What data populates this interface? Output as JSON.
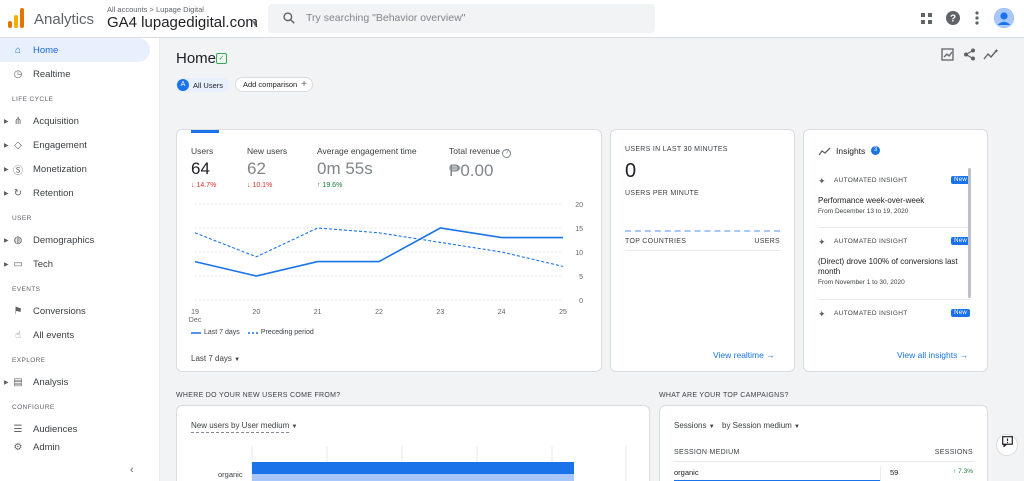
{
  "header": {
    "app_name": "Analytics",
    "account_crumb": "All accounts > Lupage Digital",
    "property": "GA4 lupagedigital.com",
    "search_placeholder": "Try searching \"Behavior overview\""
  },
  "sidebar": {
    "items": [
      {
        "label": "Home",
        "icon": "home-icon",
        "active": true
      },
      {
        "label": "Realtime",
        "icon": "clock-icon"
      }
    ],
    "sections": [
      {
        "title": "LIFE CYCLE",
        "items": [
          {
            "label": "Acquisition",
            "icon": "acquisition-icon"
          },
          {
            "label": "Engagement",
            "icon": "tag-icon"
          },
          {
            "label": "Monetization",
            "icon": "dollar-icon"
          },
          {
            "label": "Retention",
            "icon": "retention-icon"
          }
        ]
      },
      {
        "title": "USER",
        "items": [
          {
            "label": "Demographics",
            "icon": "globe-icon"
          },
          {
            "label": "Tech",
            "icon": "device-icon"
          }
        ]
      },
      {
        "title": "EVENTS",
        "items": [
          {
            "label": "Conversions",
            "icon": "flag-icon"
          },
          {
            "label": "All events",
            "icon": "touch-icon"
          }
        ]
      },
      {
        "title": "EXPLORE",
        "items": [
          {
            "label": "Analysis",
            "icon": "analysis-icon"
          }
        ]
      },
      {
        "title": "CONFIGURE",
        "items": [
          {
            "label": "Audiences",
            "icon": "audiences-icon"
          },
          {
            "label": "Admin",
            "icon": "gear-icon"
          }
        ]
      }
    ]
  },
  "main": {
    "title": "Home",
    "comparison_chip": "All Users",
    "comparison_chip_letter": "A",
    "add_comparison": "Add comparison"
  },
  "overview": {
    "metrics": [
      {
        "label": "Users",
        "value": "64",
        "change": "14.7%",
        "direction": "down"
      },
      {
        "label": "New users",
        "value": "62",
        "change": "10.1%",
        "direction": "down"
      },
      {
        "label": "Average engagement time",
        "value": "0m 55s",
        "change": "19.6%",
        "direction": "up"
      },
      {
        "label": "Total revenue",
        "value": "₱0.00",
        "change": "",
        "direction": "none"
      }
    ],
    "legend_current": "Last 7 days",
    "legend_previous": "Preceding period",
    "date_range": "Last 7 days"
  },
  "chart_data": {
    "type": "line",
    "x": [
      "19",
      "20",
      "21",
      "22",
      "23",
      "24",
      "25"
    ],
    "x_sublabel": "Dec",
    "series": [
      {
        "name": "Last 7 days",
        "values": [
          8,
          5,
          8,
          8,
          15,
          13,
          13
        ],
        "style": "solid",
        "color": "#1a73e8"
      },
      {
        "name": "Preceding period",
        "values": [
          14,
          9,
          15,
          14,
          12,
          10,
          7
        ],
        "style": "dashed",
        "color": "#1a73e8"
      }
    ],
    "y_ticks": [
      0,
      5,
      10,
      15,
      20
    ],
    "ylim": [
      0,
      20
    ]
  },
  "realtime": {
    "heading": "USERS IN LAST 30 MINUTES",
    "value": "0",
    "subheading": "USERS PER MINUTE",
    "col_left": "TOP COUNTRIES",
    "col_right": "USERS",
    "link": "View realtime"
  },
  "insights": {
    "title": "Insights",
    "count": "3",
    "items": [
      {
        "tag": "AUTOMATED INSIGHT",
        "badge": "New",
        "title": "Performance week-over-week",
        "date": "From December 13 to 19, 2020"
      },
      {
        "tag": "AUTOMATED INSIGHT",
        "badge": "New",
        "title": "(Direct) drove 100% of conversions last month",
        "date": "From November 1 to 30, 2020"
      },
      {
        "tag": "AUTOMATED INSIGHT",
        "badge": "New",
        "title": "",
        "date": ""
      }
    ],
    "link": "View all insights"
  },
  "new_users": {
    "section_title": "WHERE DO YOUR NEW USERS COME FROM?",
    "dropdown": "New users by User medium",
    "row_label": "organic"
  },
  "campaigns": {
    "section_title": "WHAT ARE YOUR TOP CAMPAIGNS?",
    "dropdown_a": "Sessions",
    "dropdown_b": "by Session medium",
    "col_left": "SESSION MEDIUM",
    "col_right": "SESSIONS",
    "row": {
      "medium": "organic",
      "sessions": "59",
      "change": "7.3%"
    }
  },
  "colors": {
    "accent": "#1a73e8",
    "up": "#188038",
    "down": "#d93025"
  }
}
